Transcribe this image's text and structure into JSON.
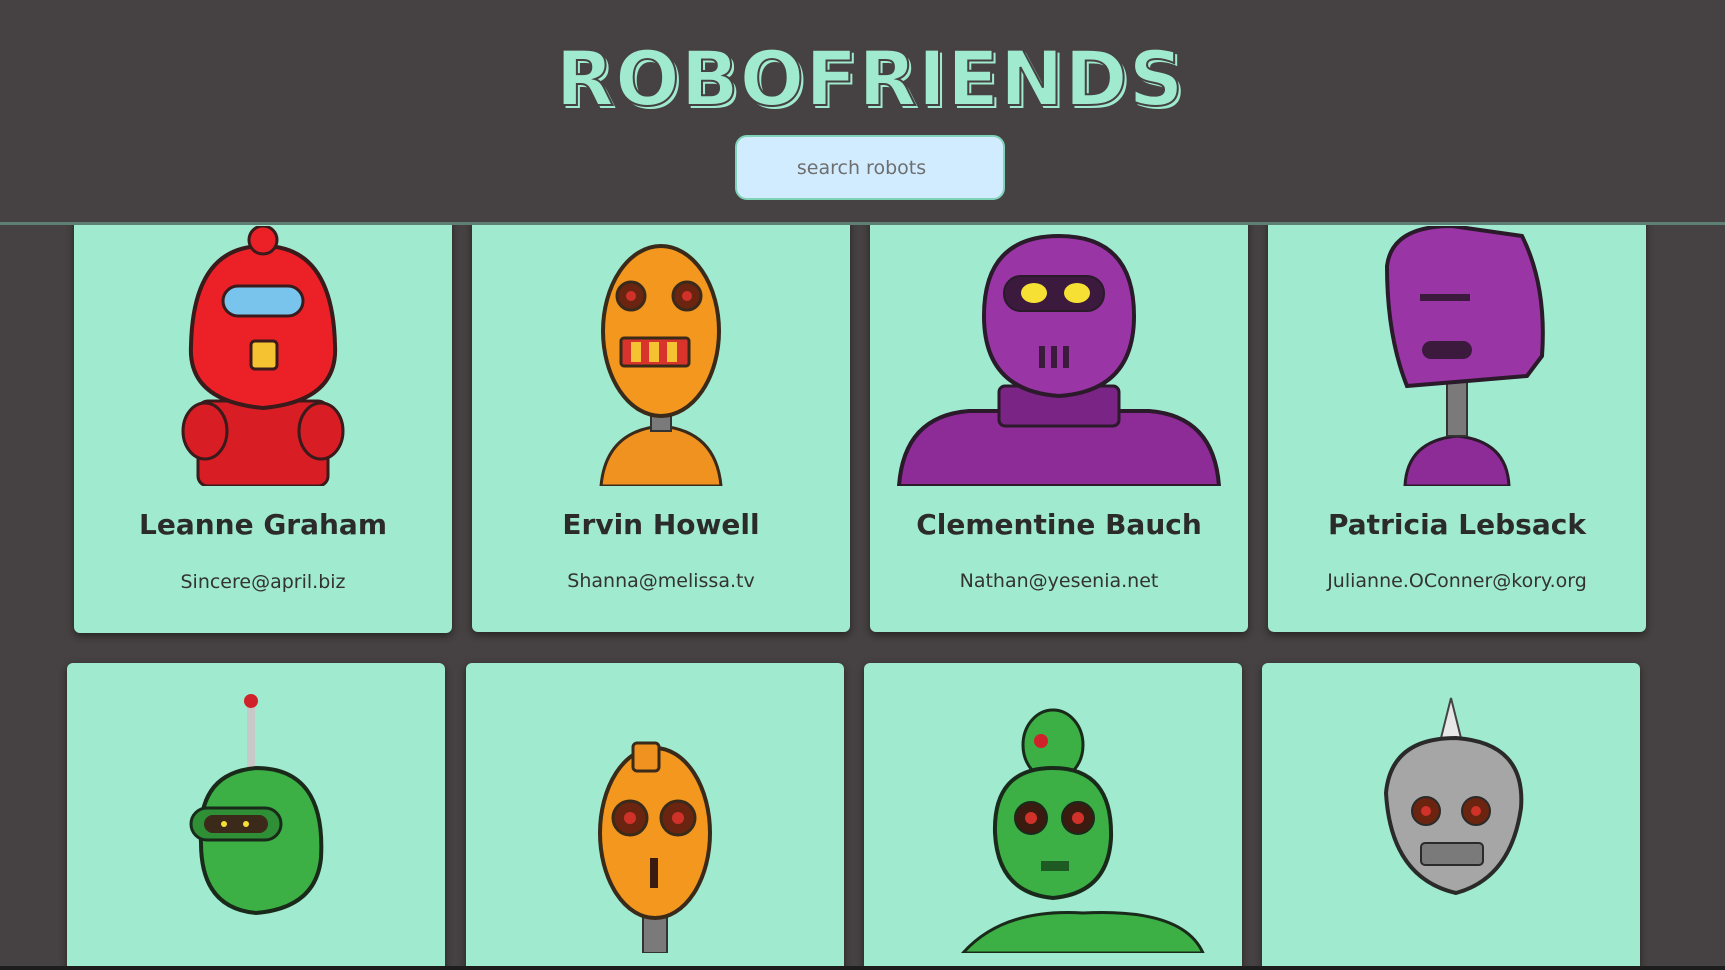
{
  "header": {
    "title": "ROBOFRIENDS",
    "search_placeholder": "search robots"
  },
  "robots": [
    {
      "name": "Leanne Graham",
      "email": "Sincere@april.biz",
      "color": "#e8232b"
    },
    {
      "name": "Ervin Howell",
      "email": "Shanna@melissa.tv",
      "color": "#f0921f"
    },
    {
      "name": "Clementine Bauch",
      "email": "Nathan@yesenia.net",
      "color": "#8d2b97"
    },
    {
      "name": "Patricia Lebsack",
      "email": "Julianne.OConner@kory.org",
      "color": "#8d2b97"
    },
    {
      "name": "",
      "email": "",
      "color": "#3caf45"
    },
    {
      "name": "",
      "email": "",
      "color": "#f0921f"
    },
    {
      "name": "",
      "email": "",
      "color": "#3caf45"
    },
    {
      "name": "",
      "email": "",
      "color": "#a6a6a6"
    }
  ]
}
